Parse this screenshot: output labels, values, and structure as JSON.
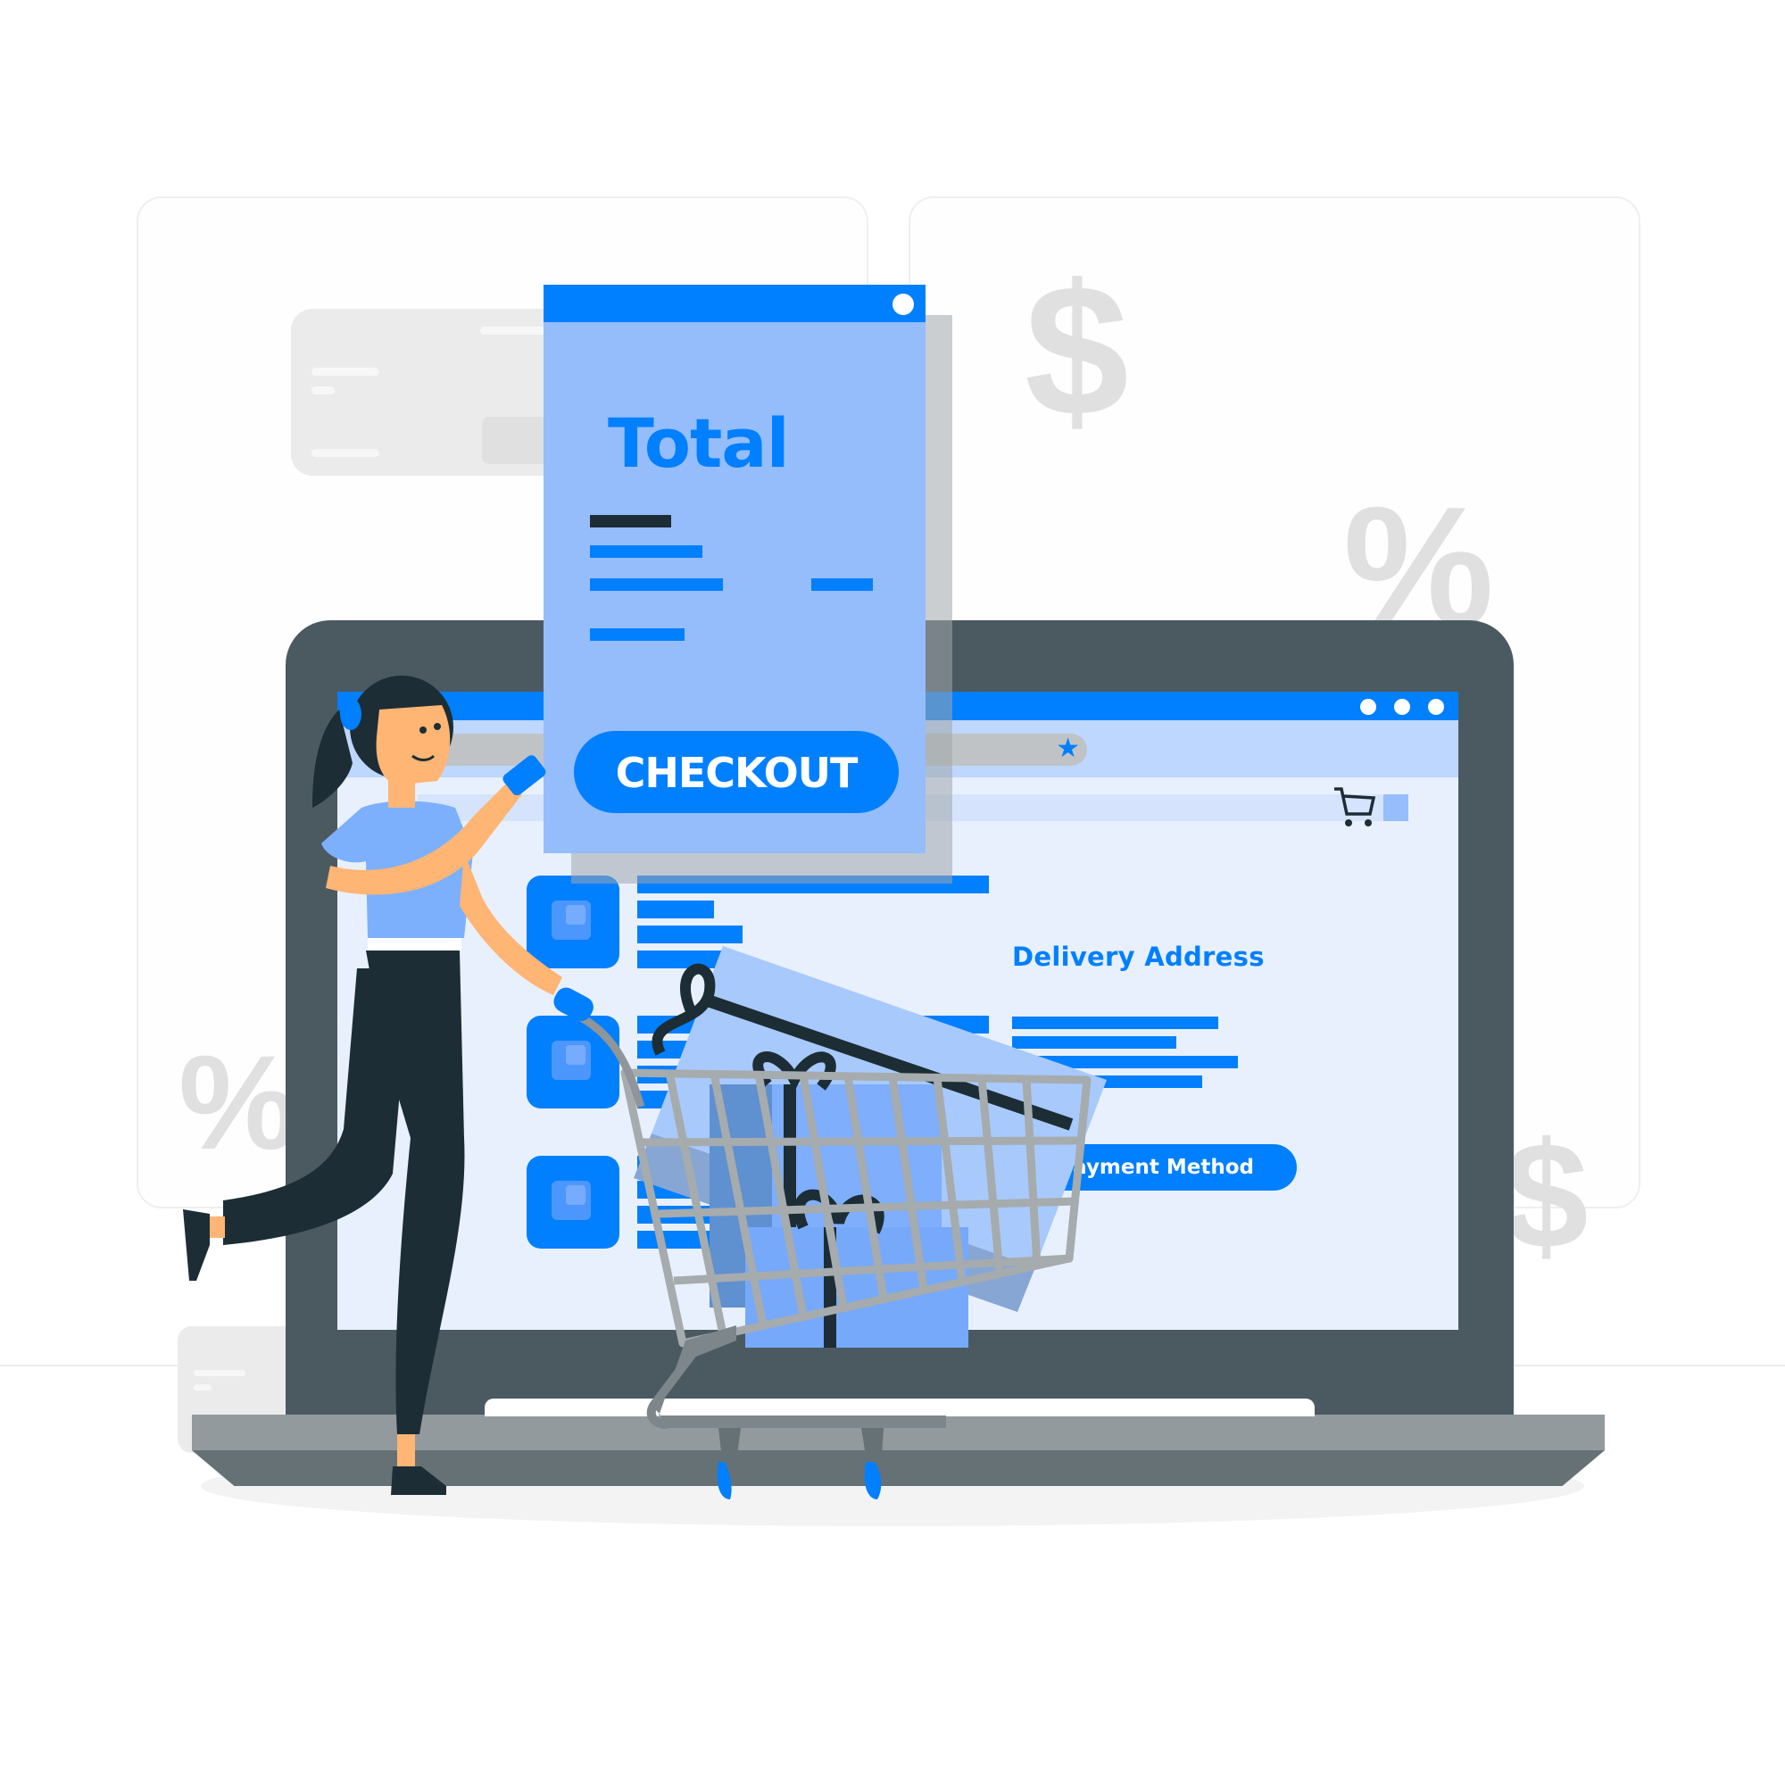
{
  "scene": {
    "description": "Online shopping checkout illustration"
  },
  "background": {
    "symbols": {
      "dollar": "$",
      "percent": "%"
    }
  },
  "receipt": {
    "title": "Total",
    "checkout_label": "CHECKOUT"
  },
  "browser": {
    "window_controls": [
      "dot",
      "dot",
      "dot"
    ],
    "bookmark_icon": "star-icon",
    "cart_icon": "shopping-cart-icon"
  },
  "store_page": {
    "products": [
      {
        "thumb": "product-thumbnail"
      },
      {
        "thumb": "product-thumbnail"
      },
      {
        "thumb": "product-thumbnail"
      }
    ],
    "delivery_title": "Delivery Address",
    "payment_label": "Payment Method"
  },
  "colors": {
    "accent": "#007fff",
    "accent_light": "#95bdfc",
    "screen_bg": "#e8f0fe",
    "laptop_body": "#4b5a61",
    "ink": "#1c2d35",
    "skin": "#ffb573",
    "cart_metal": "#a6abad"
  }
}
